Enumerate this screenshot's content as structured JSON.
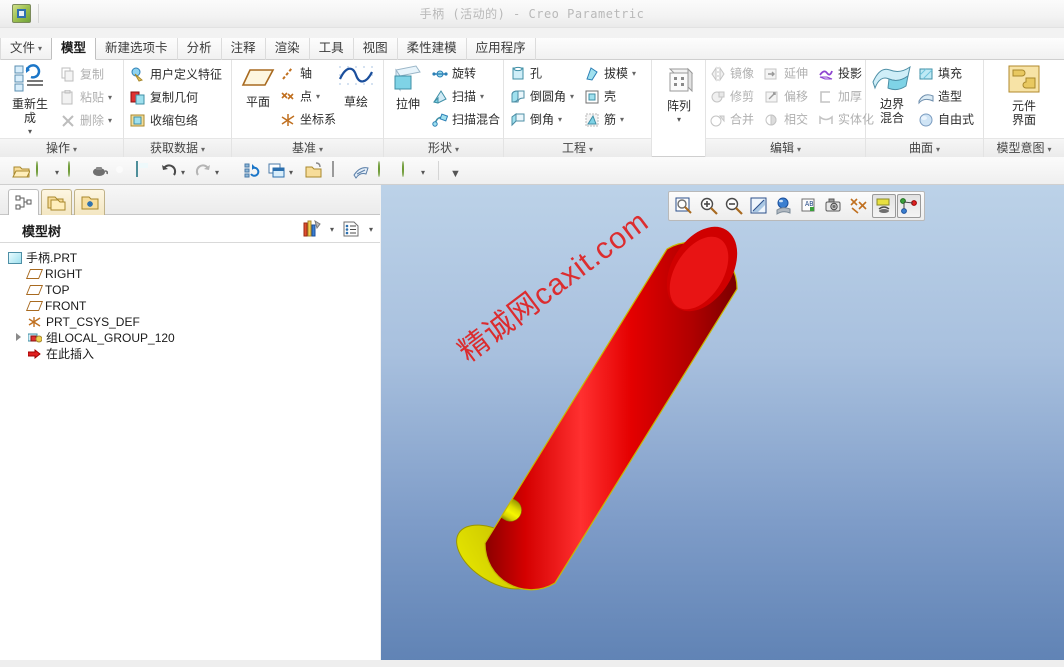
{
  "window": {
    "title": "手柄 (活动的) - Creo Parametric",
    "logo_icon": "creo-logo-icon"
  },
  "tabs": [
    {
      "label": "文件",
      "caret": "▾",
      "active": false
    },
    {
      "label": "模型",
      "caret": "",
      "active": true
    },
    {
      "label": "新建选项卡",
      "caret": "",
      "active": false
    },
    {
      "label": "分析",
      "caret": "",
      "active": false
    },
    {
      "label": "注释",
      "caret": "",
      "active": false
    },
    {
      "label": "渲染",
      "caret": "",
      "active": false
    },
    {
      "label": "工具",
      "caret": "",
      "active": false
    },
    {
      "label": "视图",
      "caret": "",
      "active": false
    },
    {
      "label": "柔性建模",
      "caret": "",
      "active": false
    },
    {
      "label": "应用程序",
      "caret": "",
      "active": false
    }
  ],
  "ribbon": {
    "groups": [
      {
        "title": "操作",
        "caret": "▾",
        "big": [
          {
            "label_line1": "重新生",
            "label_line2": "成",
            "caret": "▾",
            "icon": "regenerate-icon"
          }
        ],
        "small": [
          {
            "label": "复制",
            "icon": "copy-icon",
            "caret": "",
            "disabled": true
          },
          {
            "label": "粘贴",
            "icon": "paste-icon",
            "caret": "▾",
            "disabled": true
          },
          {
            "label": "删除",
            "icon": "delete-icon",
            "caret": "▾",
            "disabled": true
          }
        ]
      },
      {
        "title": "获取数据",
        "caret": "▾",
        "big": [],
        "small": [
          {
            "label": "用户定义特征",
            "icon": "udf-icon",
            "caret": "",
            "disabled": false
          },
          {
            "label": "复制几何",
            "icon": "copy-geometry-icon",
            "caret": "",
            "disabled": false
          },
          {
            "label": "收缩包络",
            "icon": "shrinkwrap-icon",
            "caret": "",
            "disabled": false
          }
        ]
      },
      {
        "title": "基准",
        "caret": "▾",
        "big": [
          {
            "label_line1": "平面",
            "label_line2": "",
            "caret": "",
            "icon": "datum-plane-icon"
          },
          {
            "label_line1": "草绘",
            "label_line2": "",
            "caret": "",
            "icon": "sketch-icon"
          }
        ],
        "small": [
          {
            "label": "轴",
            "icon": "datum-axis-icon",
            "caret": "",
            "disabled": false
          },
          {
            "label": "点",
            "icon": "datum-point-icon",
            "caret": "▾",
            "disabled": false
          },
          {
            "label": "坐标系",
            "icon": "datum-csys-icon",
            "caret": "",
            "disabled": false
          }
        ]
      },
      {
        "title": "形状",
        "caret": "▾",
        "big": [
          {
            "label_line1": "拉伸",
            "label_line2": "",
            "caret": "",
            "icon": "extrude-icon"
          }
        ],
        "small": [
          {
            "label": "旋转",
            "icon": "revolve-icon",
            "caret": "",
            "disabled": false
          },
          {
            "label": "扫描",
            "icon": "sweep-icon",
            "caret": "▾",
            "disabled": false
          },
          {
            "label": "扫描混合",
            "icon": "swept-blend-icon",
            "caret": "",
            "disabled": false
          }
        ]
      },
      {
        "title": "工程",
        "caret": "▾",
        "big": [],
        "small": [
          {
            "label": "孔",
            "icon": "hole-icon",
            "caret": "",
            "disabled": false
          },
          {
            "label": "倒圆角",
            "icon": "round-icon",
            "caret": "▾",
            "disabled": false
          },
          {
            "label": "倒角",
            "icon": "chamfer-icon",
            "caret": "▾",
            "disabled": false
          },
          {
            "label": "拔模",
            "icon": "draft-icon",
            "caret": "▾",
            "disabled": false
          },
          {
            "label": "壳",
            "icon": "shell-icon",
            "caret": "",
            "disabled": false
          },
          {
            "label": "筋",
            "icon": "rib-icon",
            "caret": "▾",
            "disabled": false
          }
        ]
      },
      {
        "title": "",
        "caret": "",
        "big": [
          {
            "label_line1": "阵列",
            "label_line2": "",
            "caret": "▾",
            "icon": "pattern-icon"
          }
        ],
        "small": []
      },
      {
        "title": "编辑",
        "caret": "▾",
        "big": [],
        "small": [
          {
            "label": "镜像",
            "icon": "mirror-icon",
            "caret": "",
            "disabled": true
          },
          {
            "label": "修剪",
            "icon": "trim-icon",
            "caret": "",
            "disabled": true
          },
          {
            "label": "合并",
            "icon": "merge-icon",
            "caret": "",
            "disabled": true
          },
          {
            "label": "延伸",
            "icon": "extend-icon",
            "caret": "",
            "disabled": true
          },
          {
            "label": "偏移",
            "icon": "offset-icon",
            "caret": "",
            "disabled": true
          },
          {
            "label": "相交",
            "icon": "intersect-icon",
            "caret": "",
            "disabled": true
          },
          {
            "label": "投影",
            "icon": "project-icon",
            "caret": "",
            "disabled": false
          },
          {
            "label": "加厚",
            "icon": "thicken-icon",
            "caret": "",
            "disabled": true
          },
          {
            "label": "实体化",
            "icon": "solidify-icon",
            "caret": "",
            "disabled": true
          }
        ]
      },
      {
        "title": "曲面",
        "caret": "▾",
        "big": [
          {
            "label_line1": "边界",
            "label_line2": "混合",
            "caret": "",
            "icon": "boundary-blend-icon"
          }
        ],
        "small": [
          {
            "label": "填充",
            "icon": "fill-icon",
            "caret": "",
            "disabled": false
          },
          {
            "label": "造型",
            "icon": "style-icon",
            "caret": "",
            "disabled": false
          },
          {
            "label": "自由式",
            "icon": "freestyle-icon",
            "caret": "",
            "disabled": false
          }
        ]
      },
      {
        "title": "模型意图",
        "caret": "▾",
        "big": [
          {
            "label_line1": "元件",
            "label_line2": "界面",
            "caret": "",
            "icon": "component-interface-icon"
          }
        ],
        "small": []
      }
    ]
  },
  "quick_access": {
    "buttons": [
      {
        "icon": "open-folder-icon",
        "caret": ""
      },
      {
        "icon": "globe-green-icon",
        "caret": "▾"
      },
      {
        "icon": "globe-green-icon",
        "caret": ""
      },
      {
        "icon": "teapot-icon",
        "caret": ""
      },
      {
        "icon": "gear-icon",
        "caret": ""
      },
      {
        "icon": "save-icon",
        "caret": ""
      },
      {
        "icon": "undo-icon",
        "caret": "▾"
      },
      {
        "icon": "redo-icon",
        "caret": "▾"
      },
      {
        "icon": "regenerate-model-icon",
        "caret": ""
      },
      {
        "icon": "window-switch-icon",
        "caret": "▾"
      },
      {
        "icon": "open-folder-yellow-icon",
        "caret": ""
      },
      {
        "icon": "new-page-icon",
        "caret": ""
      },
      {
        "icon": "shading-icon",
        "caret": ""
      },
      {
        "icon": "globe-green-icon",
        "caret": ""
      },
      {
        "icon": "globe-green-icon",
        "caret": "▾"
      },
      {
        "icon": "overflow-caret-icon",
        "caret": ""
      }
    ]
  },
  "left_panel": {
    "tree_tabs": [
      {
        "icon": "model-tree-icon",
        "active": true
      },
      {
        "icon": "folder-browser-icon",
        "active": false
      },
      {
        "icon": "favorites-folder-icon",
        "active": false
      }
    ],
    "header_title": "模型树",
    "header_buttons": [
      {
        "icon": "tree-filter-icon",
        "caret": "▾"
      },
      {
        "icon": "tree-settings-icon",
        "caret": "▾"
      }
    ],
    "tree_nodes": [
      {
        "label": "手柄.PRT",
        "icon": "part-icon",
        "indent": 0,
        "expander": false
      },
      {
        "label": "RIGHT",
        "icon": "datum-plane-icon",
        "indent": 1,
        "expander": false
      },
      {
        "label": "TOP",
        "icon": "datum-plane-icon",
        "indent": 1,
        "expander": false
      },
      {
        "label": "FRONT",
        "icon": "datum-plane-icon",
        "indent": 1,
        "expander": false
      },
      {
        "label": "PRT_CSYS_DEF",
        "icon": "datum-csys-icon",
        "indent": 1,
        "expander": false
      },
      {
        "label": "组LOCAL_GROUP_120",
        "icon": "group-icon",
        "indent": 1,
        "expander": true
      },
      {
        "label": "在此插入",
        "icon": "insert-here-icon",
        "indent": 1,
        "expander": false
      }
    ]
  },
  "graphics": {
    "toolbar_buttons": [
      {
        "icon": "zoom-fit-icon",
        "pressed": false
      },
      {
        "icon": "zoom-in-icon",
        "pressed": false
      },
      {
        "icon": "zoom-out-icon",
        "pressed": false
      },
      {
        "icon": "repaint-icon",
        "pressed": false
      },
      {
        "icon": "display-style-icon",
        "pressed": false
      },
      {
        "icon": "annotation-display-icon",
        "pressed": false
      },
      {
        "icon": "saved-view-camera-icon",
        "pressed": false
      },
      {
        "icon": "datum-display-icon",
        "pressed": false
      },
      {
        "icon": "spin-center-icon",
        "pressed": true
      },
      {
        "icon": "point-display-icon",
        "pressed": true
      }
    ],
    "watermark_text": "精诚网caxit.com",
    "background_top_color": "#bcd2e8",
    "background_bottom_color": "#5f82b4",
    "model": {
      "name": "手柄",
      "body_color": "#e00000",
      "dimple_color": "#e8e800",
      "endcap_color": "#d8d800",
      "edge_color": "#d0c000"
    }
  }
}
